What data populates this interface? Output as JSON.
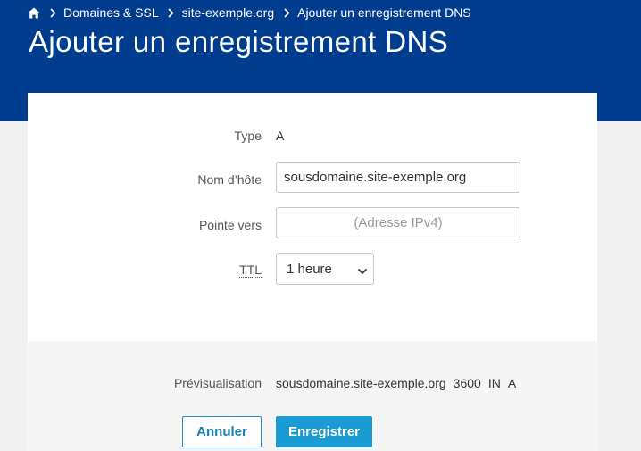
{
  "breadcrumb": {
    "home_icon": "home-icon",
    "items": [
      "Domaines & SSL",
      "site-exemple.org"
    ],
    "current": "Ajouter un enregistrement DNS"
  },
  "page": {
    "title": "Ajouter un enregistrement DNS"
  },
  "form": {
    "type": {
      "label": "Type",
      "value": "A"
    },
    "hostname": {
      "label": "Nom d’hôte",
      "value": "sousdomaine.site-exemple.org"
    },
    "points_to": {
      "label": "Pointe vers",
      "value": "",
      "placeholder": "(Adresse IPv4)"
    },
    "ttl": {
      "label": "TTL",
      "selected": "1 heure"
    }
  },
  "preview": {
    "label": "Prévisualisation",
    "host": "sousdomaine.site-exemple.org",
    "ttl": "3600",
    "class": "IN",
    "type": "A"
  },
  "buttons": {
    "cancel": "Annuler",
    "save": "Enregistrer"
  },
  "colors": {
    "header_bg": "#003d8f",
    "primary_button": "#1a9bd1",
    "secondary_button_border": "#1a8fc0"
  }
}
